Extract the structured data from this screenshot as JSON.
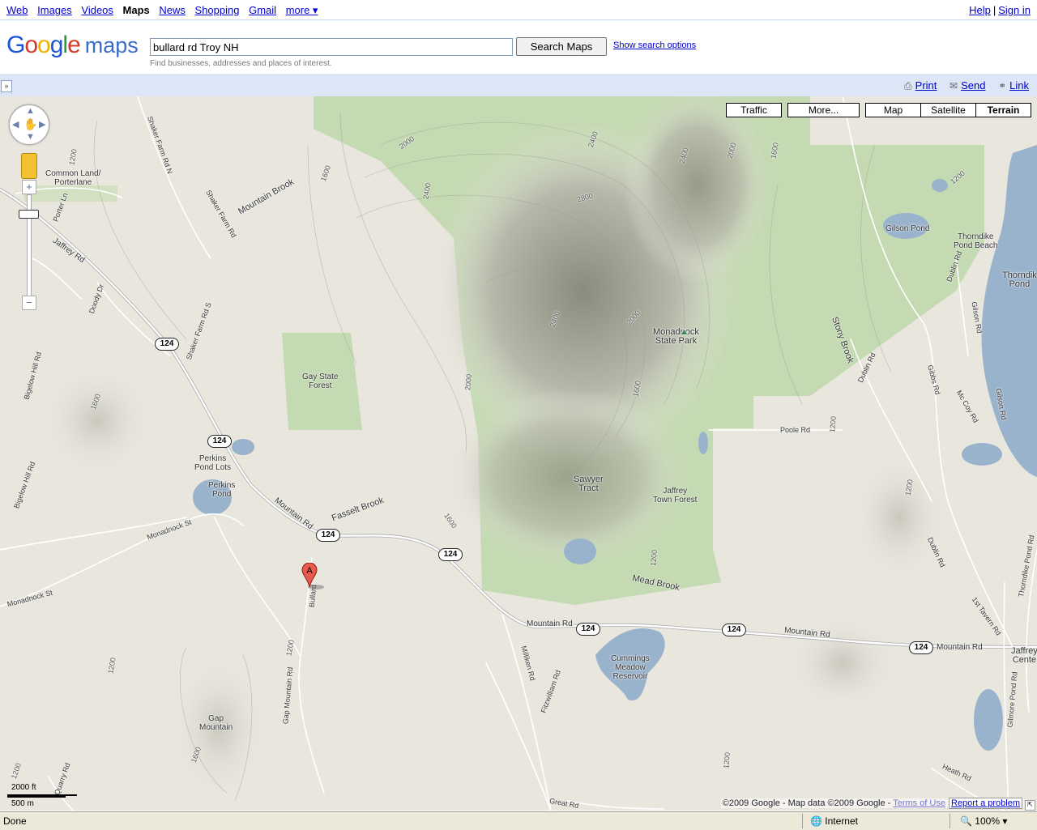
{
  "topnav": {
    "links": [
      "Web",
      "Images",
      "Videos",
      "Maps",
      "News",
      "Shopping",
      "Gmail",
      "more ▾"
    ],
    "current": "Maps",
    "help": "Help",
    "signin": "Sign in"
  },
  "header": {
    "logo_google": "Google",
    "logo_maps": "maps",
    "search_value": "bullard rd Troy NH",
    "search_button": "Search Maps",
    "show_options": "Show search options",
    "hint": "Find businesses, addresses and places of interest."
  },
  "toolbar": {
    "collapse": "»",
    "print": "Print",
    "send": "Send",
    "link": "Link"
  },
  "map_controls": {
    "traffic": "Traffic",
    "more": "More...",
    "map": "Map",
    "satellite": "Satellite",
    "terrain": "Terrain",
    "selected": "Terrain",
    "zoom_in": "+",
    "zoom_out": "−"
  },
  "map_labels": {
    "common_land": "Common Land/\nPorterlane",
    "mountain_brook": "Mountain Brook",
    "gay_state_forest": "Gay State\nForest",
    "perkins_pond_lots": "Perkins\nPond Lots",
    "perkins_pond": "Perkins\nPond",
    "monadnock_state_park": "Monadnock\nState Park",
    "sawyer_tract": "Sawyer\nTract",
    "jaffrey_town_forest": "Jaffrey\nTown Forest",
    "gilson_pond": "Gilson Pond",
    "thorndike_pond_beach": "Thorndike\nPond Beach",
    "thorndike_pond": "Thorndik\nPond",
    "cummings_meadow_reservoir": "Cummings\nMeadow\nReservoir",
    "gap_mountain": "Gap\nMountain",
    "jaffrey_center": "Jaffrey\nCente",
    "fasselt_brook": "Fasselt Brook",
    "mead_brook": "Mead Brook",
    "stony_brook": "Stony Brook"
  },
  "road_labels": {
    "jaffrey_rd": "Jaffrey Rd",
    "shaker_farm_rd_n": "Shaker Farm Rd N",
    "shaker_farm_rd": "Shaker Farm Rd",
    "shaker_farm_rd_s": "Shaker Farm Rd S",
    "porter_ln": "Porter Ln",
    "doody_dr": "Doody Dr",
    "bigelow_hill_rd": "Bigelow Hill Rd",
    "monadnock_st": "Monadnock St",
    "mountain_rd": "Mountain Rd",
    "gap_mountain_rd": "Gap Mountain Rd",
    "bullard_rd": "Bullard",
    "poole_rd": "Poole Rd",
    "dublin_rd": "Dublin Rd",
    "gilson_rd": "Gilson Rd",
    "gibbs_rd": "Gibbs Rd",
    "mc_coy_rd": "Mc Coy Rd",
    "thorndike_pond_rd": "Thorndike Pond Rd",
    "first_tavern_rd": "1st Tavern Rd",
    "milliken_rd": "Milliken Rd",
    "fitzwilliam_rd": "Fitzwilliam Rd",
    "heath_rd": "Heath Rd",
    "great_rd": "Great Rd",
    "quarry_rd": "Quarry Rd",
    "gilmore_pond_rd": "Gilmore Pond Rd"
  },
  "route_shield": "124",
  "marker_label": "A",
  "elevations": [
    "2000",
    "2400",
    "2800",
    "1600",
    "1200"
  ],
  "scale": {
    "feet": "2000 ft",
    "meters": "500 m"
  },
  "copyright": {
    "text": "©2009 Google - Map data ©2009 Google - ",
    "terms": "Terms of Use",
    "report": "Report a problem"
  },
  "statusbar": {
    "done": "Done",
    "zone": "Internet",
    "zoom": "100%"
  }
}
